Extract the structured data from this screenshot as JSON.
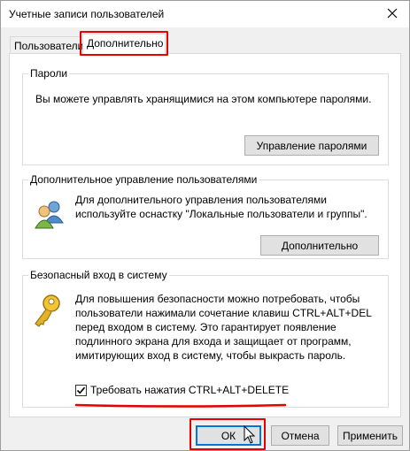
{
  "window": {
    "title": "Учетные записи пользователей"
  },
  "tabs": [
    {
      "label": "Пользователи"
    },
    {
      "label": "Дополнительно"
    }
  ],
  "passwords": {
    "legend": "Пароли",
    "text": "Вы можете управлять хранящимися на этом компьютере паролями.",
    "button": "Управление паролями"
  },
  "advanced": {
    "legend": "Дополнительное управление пользователями",
    "text_line1": "Для дополнительного управления пользователями",
    "text_line2": "используйте оснастку \"Локальные пользователи и группы\".",
    "button": "Дополнительно"
  },
  "secure": {
    "legend": "Безопасный вход в систему",
    "text_line1": "Для повышения безопасности можно потребовать, чтобы",
    "text_line2": "пользователи нажимали сочетание клавиш CTRL+ALT+DEL",
    "text_line3": "перед входом в систему. Это гарантирует появление",
    "text_line4": "подлинного экрана для входа и защищает от программ,",
    "text_line5": "имитирующих вход в систему, чтобы выкрасть пароль.",
    "checkbox_label": "Требовать нажатия CTRL+ALT+DELETE",
    "checkbox_checked": true
  },
  "footer": {
    "ok": "ОК",
    "cancel": "Отмена",
    "apply": "Применить"
  },
  "colors": {
    "highlight": "#e60000",
    "accent": "#0078d7"
  },
  "icons": [
    "close-icon",
    "users-icon",
    "key-icon",
    "checkmark-icon",
    "mouse-cursor-icon"
  ]
}
